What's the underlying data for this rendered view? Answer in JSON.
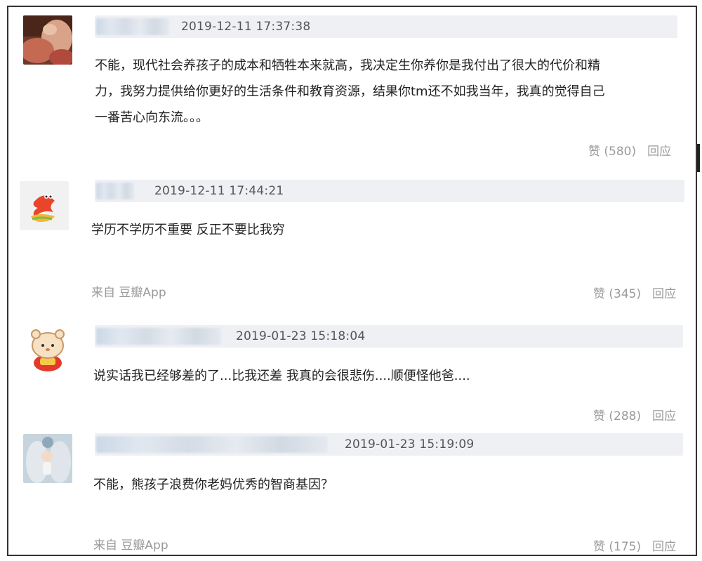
{
  "comments": [
    {
      "timestamp": "2019-12-11 17:37:38",
      "lines": [
        "不能，现代社会养孩子的成本和牺牲本来就高，我决定生你养你是我付出了很大的代价和精",
        "力，我努力提供给你更好的生活条件和教育资源，结果你tm还不如我当年，我真的觉得自己",
        "一番苦心向东流。。。"
      ],
      "like_label": "赞 (580)",
      "reply_label": "回应",
      "source": ""
    },
    {
      "timestamp": "2019-12-11 17:44:21",
      "lines": [
        "学历不学历不重要 反正不要比我穷"
      ],
      "like_label": "赞 (345)",
      "reply_label": "回应",
      "source": "来自 豆瓣App"
    },
    {
      "timestamp": "2019-01-23 15:18:04",
      "lines": [
        "说实话我已经够差的了...比我还差 我真的会很悲伤....顺便怪他爸...."
      ],
      "like_label": "赞 (288)",
      "reply_label": "回应",
      "source": ""
    },
    {
      "timestamp": "2019-01-23 15:19:09",
      "lines": [
        "不能，熊孩子浪费你老妈优秀的智商基因？"
      ],
      "like_label": "赞 (175)",
      "reply_label": "回应",
      "source": "来自 豆瓣App"
    }
  ]
}
